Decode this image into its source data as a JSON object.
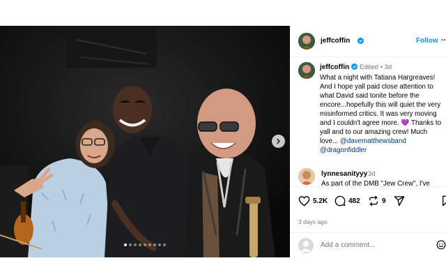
{
  "post": {
    "username": "jeffcoffin",
    "follow_label": "Follow",
    "more_label": "···",
    "edited_label": "Edited",
    "dot_sep": "•",
    "time": "3d",
    "caption": "What a night with Tatiana Hargreaves! And I hope yall paid close attention to what David said tonite before the encore...hopefully this will quiet the very misinformed critics. It was very moving and I couldn't agree more. ",
    "heart": "💜",
    "caption_tail": " Thanks to yall and to our amazing crew! Much love... ",
    "mention1": "@davematthewsband",
    "mention2": "@dragonfiddler",
    "carousel_dots": 9,
    "carousel_active": 0
  },
  "comment": {
    "username": "lynnesanityyy",
    "time": "3d",
    "text": "As part of the DMB \"Jew Crew\", I've"
  },
  "actions": {
    "likes": "5.2K",
    "comments": "482",
    "reposts": "9",
    "time_ago": "3 days ago",
    "icons": [
      "heart-icon",
      "comment-icon",
      "repost-icon",
      "share-icon",
      "bookmark-icon"
    ]
  },
  "composer": {
    "placeholder": "Add a comment..."
  },
  "colors": {
    "accent": "#0095f6",
    "mention": "#00376b",
    "verified": "#0095f6"
  }
}
